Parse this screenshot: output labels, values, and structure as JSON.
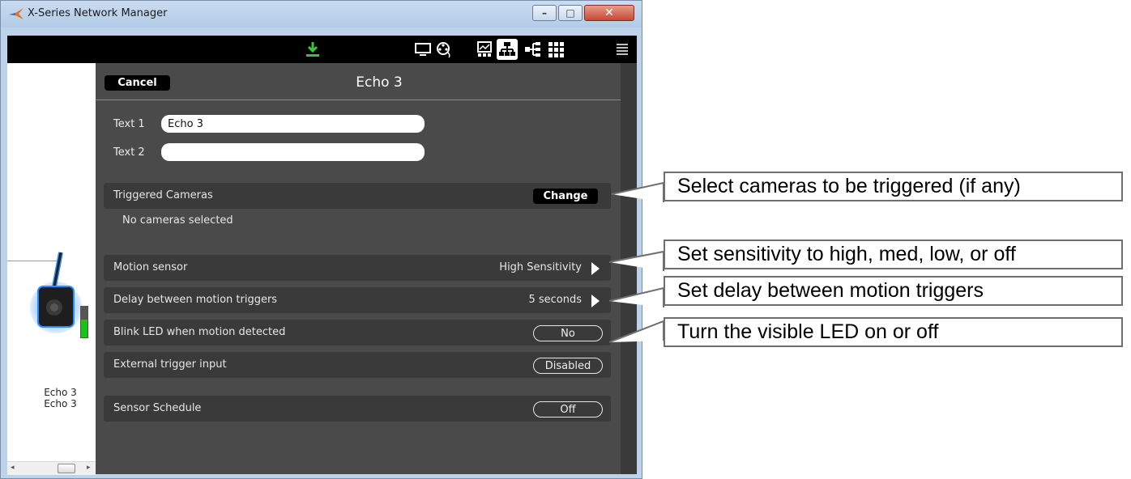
{
  "window": {
    "title": "X-Series Network Manager",
    "close_glyph": "✕",
    "min_glyph": "–",
    "max_glyph": "□"
  },
  "toolbar": {
    "icons": [
      "download-icon",
      "monitor-icon",
      "reel-icon",
      "chart-icon",
      "network-icon",
      "tree-icon",
      "grid-icon",
      "menu-icon"
    ],
    "accent": "#3ac43a"
  },
  "left_pane": {
    "device_label_1": "Echo 3",
    "device_label_2": "Echo 3",
    "scroll_left": "◂",
    "scroll_right": "▸"
  },
  "header": {
    "cancel_label": "Cancel",
    "title": "Echo 3"
  },
  "fields": {
    "text1_label": "Text 1",
    "text1_value": "Echo 3",
    "text2_label": "Text 2",
    "text2_value": ""
  },
  "settings": {
    "triggered_cameras": {
      "label": "Triggered Cameras",
      "button": "Change",
      "note": "No cameras selected"
    },
    "motion_sensor": {
      "label": "Motion sensor",
      "value": "High Sensitivity"
    },
    "delay": {
      "label": "Delay between motion triggers",
      "value": "5 seconds"
    },
    "blink_led": {
      "label": "Blink LED when motion detected",
      "value": "No"
    },
    "external_trigger": {
      "label": "External trigger input",
      "value": "Disabled"
    },
    "schedule": {
      "label": "Sensor Schedule",
      "value": "Off"
    }
  },
  "callouts": {
    "cameras": "Select cameras to be triggered (if any)",
    "sensitivity": "Set sensitivity to high, med, low, or off",
    "delay": "Set delay between motion triggers",
    "led": "Turn the visible LED on or off"
  },
  "colors": {
    "panel_bg": "#4a4a4a",
    "row_bg": "#3a3a3a",
    "battery_green": "#19c419",
    "device_glow": "#2a8cff"
  }
}
